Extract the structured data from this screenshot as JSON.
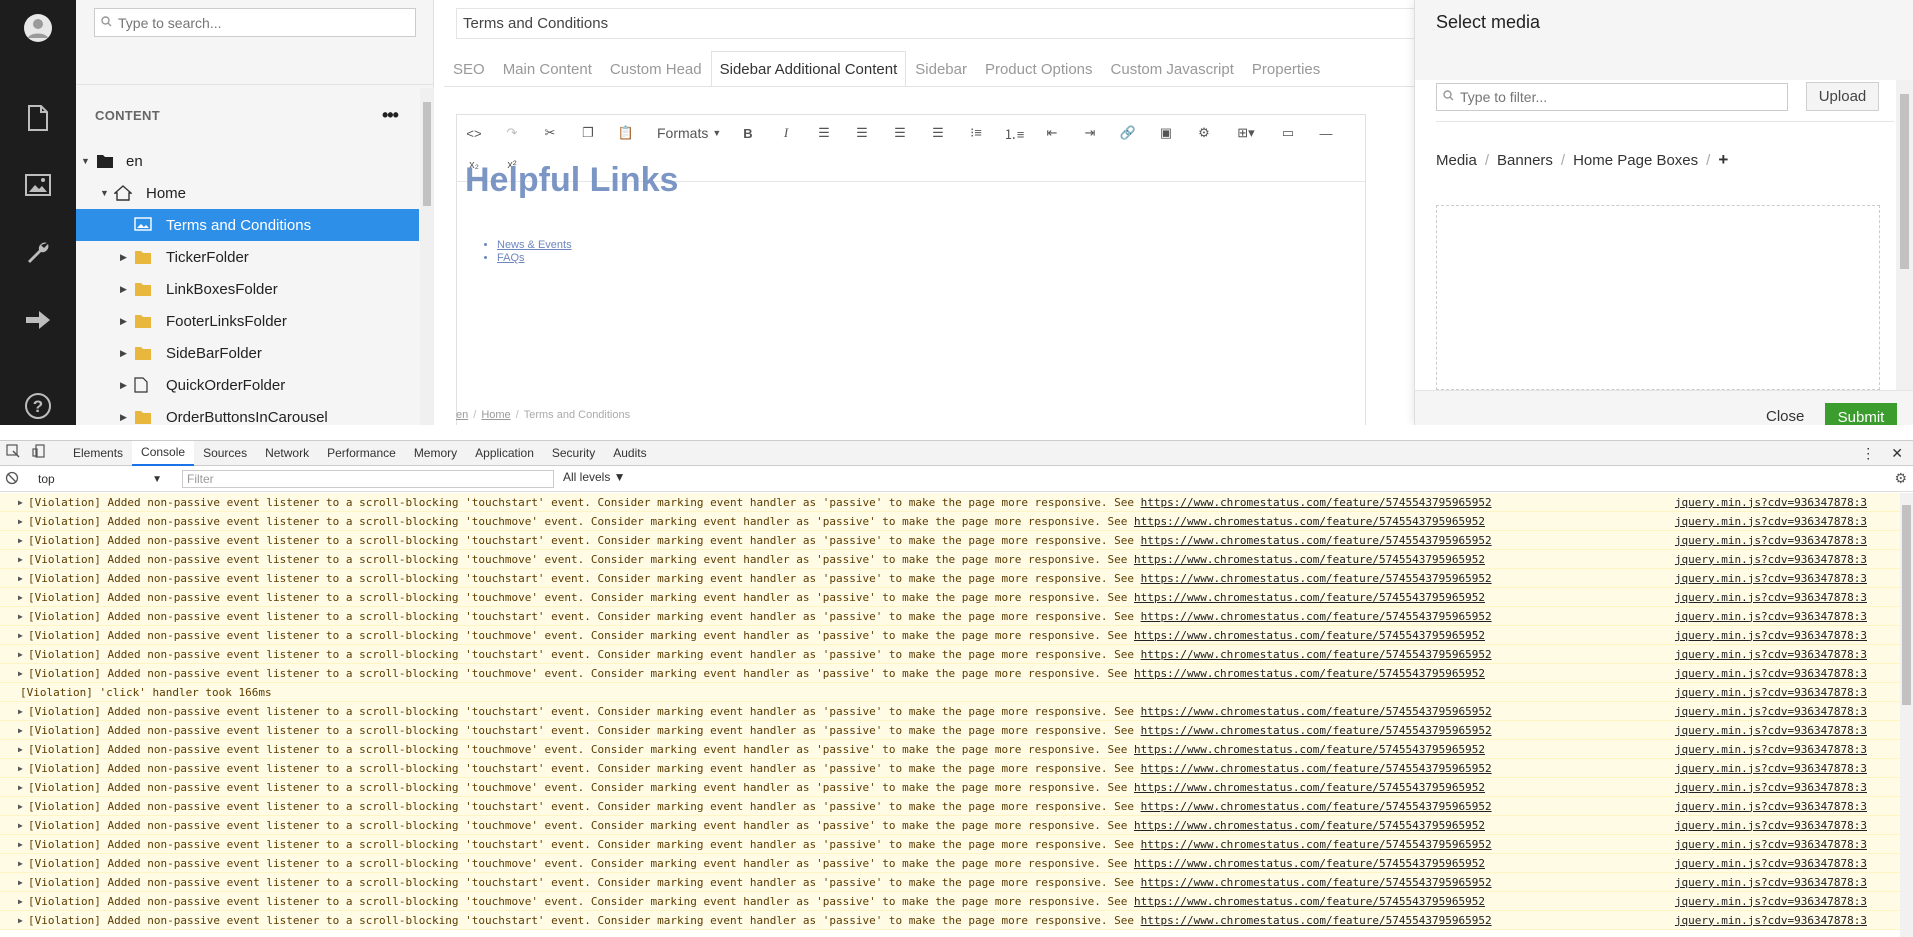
{
  "left_nav": {
    "items": [
      {
        "name": "avatar",
        "icon": "user-avatar-icon"
      },
      {
        "name": "content",
        "icon": "document-icon"
      },
      {
        "name": "media",
        "icon": "image-icon"
      },
      {
        "name": "settings",
        "icon": "wrench-icon"
      },
      {
        "name": "forms",
        "icon": "arrow-right-icon"
      },
      {
        "name": "help",
        "icon": "question-icon"
      }
    ]
  },
  "tree": {
    "search_placeholder": "Type to search...",
    "section_title": "CONTENT",
    "menu_glyph": "•••",
    "nodes": [
      {
        "label": "en",
        "level": 0,
        "icon": "folder-dark-icon",
        "expanded": true
      },
      {
        "label": "Home",
        "level": 1,
        "icon": "home-icon",
        "expanded": true
      },
      {
        "label": "Terms and Conditions",
        "level": 2,
        "icon": "image-icon",
        "selected": true
      },
      {
        "label": "TickerFolder",
        "level": 2,
        "icon": "folder-icon",
        "collapsed": true
      },
      {
        "label": "LinkBoxesFolder",
        "level": 2,
        "icon": "folder-icon",
        "collapsed": true
      },
      {
        "label": "FooterLinksFolder",
        "level": 2,
        "icon": "folder-icon",
        "collapsed": true
      },
      {
        "label": "SideBarFolder",
        "level": 2,
        "icon": "folder-icon",
        "collapsed": true
      },
      {
        "label": "QuickOrderFolder",
        "level": 2,
        "icon": "page-icon",
        "collapsed": true
      },
      {
        "label": "OrderButtonsInCarousel",
        "level": 2,
        "icon": "folder-icon",
        "collapsed": true
      }
    ]
  },
  "editor": {
    "doc_title": "Terms and Conditions",
    "tabs": [
      "SEO",
      "Main Content",
      "Custom Head",
      "Sidebar Additional Content",
      "Sidebar",
      "Product Options",
      "Custom Javascript",
      "Properties"
    ],
    "active_tab": "Sidebar Additional Content",
    "formats_label": "Formats",
    "heading": "Helpful Links",
    "links": [
      "News & Events",
      "FAQs"
    ],
    "breadcrumb": [
      "en",
      "Home",
      "Terms and Conditions"
    ]
  },
  "dialog": {
    "title": "Select media",
    "filter_placeholder": "Type to filter...",
    "upload_label": "Upload",
    "crumbs": [
      "Media",
      "Banners",
      "Home Page Boxes"
    ],
    "add_glyph": "+",
    "close_label": "Close",
    "submit_label": "Submit",
    "submit_color": "#3c9d2f"
  },
  "devtools": {
    "tabs": [
      "Elements",
      "Console",
      "Sources",
      "Network",
      "Performance",
      "Memory",
      "Application",
      "Security",
      "Audits"
    ],
    "active_tab": "Console",
    "context": "top",
    "filter_placeholder": "Filter",
    "levels": "All levels ▼",
    "messages": [
      {
        "text": "[Violation] Added non-passive event listener to a scroll-blocking 'touchstart' event. Consider marking event handler as 'passive' to make the page more responsive. See ",
        "link": "https://www.chromestatus.com/feature/5745543795965952",
        "source": "jquery.min.js?cdv=936347878:3"
      },
      {
        "text": "[Violation] Added non-passive event listener to a scroll-blocking 'touchmove' event. Consider marking event handler as 'passive' to make the page more responsive. See ",
        "link": "https://www.chromestatus.com/feature/5745543795965952",
        "source": "jquery.min.js?cdv=936347878:3"
      },
      {
        "text": "[Violation] Added non-passive event listener to a scroll-blocking 'touchstart' event. Consider marking event handler as 'passive' to make the page more responsive. See ",
        "link": "https://www.chromestatus.com/feature/5745543795965952",
        "source": "jquery.min.js?cdv=936347878:3"
      },
      {
        "text": "[Violation] Added non-passive event listener to a scroll-blocking 'touchmove' event. Consider marking event handler as 'passive' to make the page more responsive. See ",
        "link": "https://www.chromestatus.com/feature/5745543795965952",
        "source": "jquery.min.js?cdv=936347878:3"
      },
      {
        "text": "[Violation] Added non-passive event listener to a scroll-blocking 'touchstart' event. Consider marking event handler as 'passive' to make the page more responsive. See ",
        "link": "https://www.chromestatus.com/feature/5745543795965952",
        "source": "jquery.min.js?cdv=936347878:3"
      },
      {
        "text": "[Violation] Added non-passive event listener to a scroll-blocking 'touchmove' event. Consider marking event handler as 'passive' to make the page more responsive. See ",
        "link": "https://www.chromestatus.com/feature/5745543795965952",
        "source": "jquery.min.js?cdv=936347878:3"
      },
      {
        "text": "[Violation] Added non-passive event listener to a scroll-blocking 'touchstart' event. Consider marking event handler as 'passive' to make the page more responsive. See ",
        "link": "https://www.chromestatus.com/feature/5745543795965952",
        "source": "jquery.min.js?cdv=936347878:3"
      },
      {
        "text": "[Violation] Added non-passive event listener to a scroll-blocking 'touchmove' event. Consider marking event handler as 'passive' to make the page more responsive. See ",
        "link": "https://www.chromestatus.com/feature/5745543795965952",
        "source": "jquery.min.js?cdv=936347878:3"
      },
      {
        "text": "[Violation] Added non-passive event listener to a scroll-blocking 'touchstart' event. Consider marking event handler as 'passive' to make the page more responsive. See ",
        "link": "https://www.chromestatus.com/feature/5745543795965952",
        "source": "jquery.min.js?cdv=936347878:3"
      },
      {
        "text": "[Violation] Added non-passive event listener to a scroll-blocking 'touchmove' event. Consider marking event handler as 'passive' to make the page more responsive. See ",
        "link": "https://www.chromestatus.com/feature/5745543795965952",
        "source": "jquery.min.js?cdv=936347878:3"
      },
      {
        "text": "[Violation] 'click' handler took 166ms",
        "link": "",
        "source": "jquery.min.js?cdv=936347878:3",
        "plain": true
      },
      {
        "text": "[Violation] Added non-passive event listener to a scroll-blocking 'touchstart' event. Consider marking event handler as 'passive' to make the page more responsive. See ",
        "link": "https://www.chromestatus.com/feature/5745543795965952",
        "source": "jquery.min.js?cdv=936347878:3"
      },
      {
        "text": "[Violation] Added non-passive event listener to a scroll-blocking 'touchstart' event. Consider marking event handler as 'passive' to make the page more responsive. See ",
        "link": "https://www.chromestatus.com/feature/5745543795965952",
        "source": "jquery.min.js?cdv=936347878:3"
      },
      {
        "text": "[Violation] Added non-passive event listener to a scroll-blocking 'touchmove' event. Consider marking event handler as 'passive' to make the page more responsive. See ",
        "link": "https://www.chromestatus.com/feature/5745543795965952",
        "source": "jquery.min.js?cdv=936347878:3"
      },
      {
        "text": "[Violation] Added non-passive event listener to a scroll-blocking 'touchstart' event. Consider marking event handler as 'passive' to make the page more responsive. See ",
        "link": "https://www.chromestatus.com/feature/5745543795965952",
        "source": "jquery.min.js?cdv=936347878:3"
      },
      {
        "text": "[Violation] Added non-passive event listener to a scroll-blocking 'touchmove' event. Consider marking event handler as 'passive' to make the page more responsive. See ",
        "link": "https://www.chromestatus.com/feature/5745543795965952",
        "source": "jquery.min.js?cdv=936347878:3"
      },
      {
        "text": "[Violation] Added non-passive event listener to a scroll-blocking 'touchstart' event. Consider marking event handler as 'passive' to make the page more responsive. See ",
        "link": "https://www.chromestatus.com/feature/5745543795965952",
        "source": "jquery.min.js?cdv=936347878:3"
      },
      {
        "text": "[Violation] Added non-passive event listener to a scroll-blocking 'touchmove' event. Consider marking event handler as 'passive' to make the page more responsive. See ",
        "link": "https://www.chromestatus.com/feature/5745543795965952",
        "source": "jquery.min.js?cdv=936347878:3"
      },
      {
        "text": "[Violation] Added non-passive event listener to a scroll-blocking 'touchstart' event. Consider marking event handler as 'passive' to make the page more responsive. See ",
        "link": "https://www.chromestatus.com/feature/5745543795965952",
        "source": "jquery.min.js?cdv=936347878:3"
      },
      {
        "text": "[Violation] Added non-passive event listener to a scroll-blocking 'touchmove' event. Consider marking event handler as 'passive' to make the page more responsive. See ",
        "link": "https://www.chromestatus.com/feature/5745543795965952",
        "source": "jquery.min.js?cdv=936347878:3"
      },
      {
        "text": "[Violation] Added non-passive event listener to a scroll-blocking 'touchstart' event. Consider marking event handler as 'passive' to make the page more responsive. See ",
        "link": "https://www.chromestatus.com/feature/5745543795965952",
        "source": "jquery.min.js?cdv=936347878:3"
      },
      {
        "text": "[Violation] Added non-passive event listener to a scroll-blocking 'touchmove' event. Consider marking event handler as 'passive' to make the page more responsive. See ",
        "link": "https://www.chromestatus.com/feature/5745543795965952",
        "source": "jquery.min.js?cdv=936347878:3"
      },
      {
        "text": "[Violation] Added non-passive event listener to a scroll-blocking 'touchstart' event. Consider marking event handler as 'passive' to make the page more responsive. See ",
        "link": "https://www.chromestatus.com/feature/5745543795965952",
        "source": "jquery.min.js?cdv=936347878:3"
      }
    ]
  }
}
